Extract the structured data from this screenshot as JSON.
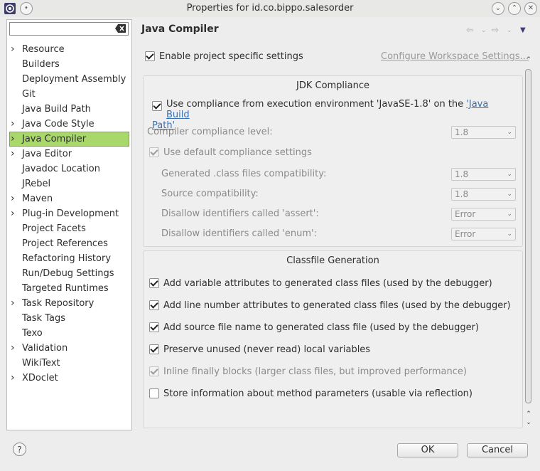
{
  "window": {
    "title": "Properties for id.co.bippo.salesorder"
  },
  "filter": {
    "value": ""
  },
  "tree": [
    {
      "label": "Resource",
      "expandable": true
    },
    {
      "label": "Builders",
      "expandable": false
    },
    {
      "label": "Deployment Assembly",
      "expandable": false
    },
    {
      "label": "Git",
      "expandable": false
    },
    {
      "label": "Java Build Path",
      "expandable": false
    },
    {
      "label": "Java Code Style",
      "expandable": true
    },
    {
      "label": "Java Compiler",
      "expandable": true,
      "selected": true
    },
    {
      "label": "Java Editor",
      "expandable": true
    },
    {
      "label": "Javadoc Location",
      "expandable": false
    },
    {
      "label": "JRebel",
      "expandable": false
    },
    {
      "label": "Maven",
      "expandable": true
    },
    {
      "label": "Plug-in Development",
      "expandable": true
    },
    {
      "label": "Project Facets",
      "expandable": false
    },
    {
      "label": "Project References",
      "expandable": false
    },
    {
      "label": "Refactoring History",
      "expandable": false
    },
    {
      "label": "Run/Debug Settings",
      "expandable": false
    },
    {
      "label": "Targeted Runtimes",
      "expandable": false
    },
    {
      "label": "Task Repository",
      "expandable": true
    },
    {
      "label": "Task Tags",
      "expandable": false
    },
    {
      "label": "Texo",
      "expandable": false
    },
    {
      "label": "Validation",
      "expandable": true
    },
    {
      "label": "WikiText",
      "expandable": false
    },
    {
      "label": "XDoclet",
      "expandable": true
    }
  ],
  "page": {
    "title": "Java Compiler",
    "enable_specific": "Enable project specific settings",
    "configure_link": "Configure Workspace Settings...",
    "jdk_group": {
      "title": "JDK Compliance",
      "use_compliance": "Use compliance from execution environment 'JavaSE-1.8' on the ",
      "java_build_path_link_1": "'Java Build",
      "java_build_path_link_2": "Path'",
      "compliance_level_label": "Compiler compliance level:",
      "compliance_level_value": "1.8",
      "use_default": "Use default compliance settings",
      "generated_label": "Generated .class files compatibility:",
      "generated_value": "1.8",
      "source_label": "Source compatibility:",
      "source_value": "1.8",
      "assert_label": "Disallow identifiers called 'assert':",
      "assert_value": "Error",
      "enum_label": "Disallow identifiers called 'enum':",
      "enum_value": "Error"
    },
    "classfile_group": {
      "title": "Classfile Generation",
      "opt1": "Add variable attributes to generated class files (used by the debugger)",
      "opt2": "Add line number attributes to generated class files (used by the debugger)",
      "opt3": "Add source file name to generated class file (used by the debugger)",
      "opt4": "Preserve unused (never read) local variables",
      "opt5": "Inline finally blocks (larger class files, but improved performance)",
      "opt6": "Store information about method parameters (usable via reflection)"
    }
  },
  "buttons": {
    "help": "?",
    "ok": "OK",
    "cancel": "Cancel"
  }
}
